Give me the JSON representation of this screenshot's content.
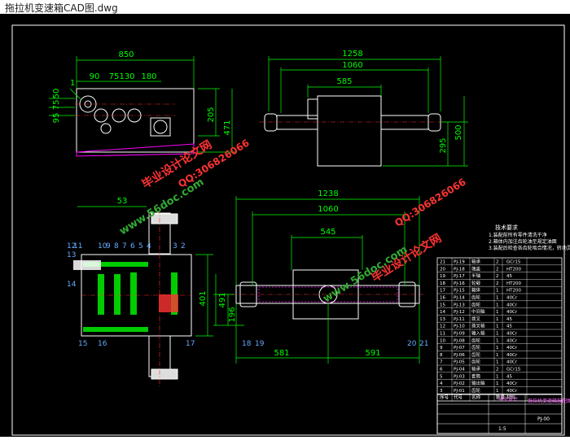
{
  "window": {
    "title": "拖拉机变速箱CAD图.dwg"
  },
  "colors": {
    "background": "#000000",
    "dimension": "#00ff00",
    "outline": "#ffffff",
    "gear": "#00cc00",
    "center": "#ff3333",
    "hatch": "#ff00ff",
    "watermark": "#ff3333",
    "watermark_url": "#33aa33"
  },
  "top_view": {
    "dims": {
      "total": "850",
      "a": "90",
      "b": "75",
      "c": "130",
      "d": "180",
      "h1": "205",
      "h2": "471",
      "v1": "95",
      "v2": "75",
      "v3": "50"
    },
    "balloon": "1"
  },
  "side_view": {
    "dims": {
      "total": "1258",
      "mid": "1060",
      "inner": "585",
      "h1": "500",
      "h2": "295"
    }
  },
  "section_view": {
    "dims": {
      "left": "53",
      "h": "401",
      "h2": "491",
      "h3": "196"
    },
    "balloons": [
      "12",
      "11",
      "13",
      "10",
      "9",
      "8",
      "7",
      "6",
      "5",
      "4",
      "3",
      "2",
      "14",
      "15",
      "16",
      "17"
    ]
  },
  "front_view": {
    "dims": {
      "total": "1238",
      "mid": "1060",
      "inner": "545",
      "left": "581",
      "right": "591"
    },
    "balloons": [
      "18",
      "19",
      "20",
      "21"
    ]
  },
  "bom": {
    "tech_title": "技术要求",
    "tech_lines": [
      "1.装配前所有零件清洗干净",
      "2.箱体内加注齿轮油至规定油面",
      "3.装配后检查各齿轮啮合情况，转动灵活"
    ],
    "rows": [
      {
        "no": "21",
        "code": "PJ-19",
        "name": "轴承",
        "qty": "2",
        "mat": "GCr15"
      },
      {
        "no": "20",
        "code": "PJ-18",
        "name": "端盖",
        "qty": "2",
        "mat": "HT200"
      },
      {
        "no": "19",
        "code": "PJ-17",
        "name": "半轴",
        "qty": "2",
        "mat": "45"
      },
      {
        "no": "18",
        "code": "PJ-16",
        "name": "轮毂",
        "qty": "2",
        "mat": "HT200"
      },
      {
        "no": "17",
        "code": "PJ-15",
        "name": "箱体",
        "qty": "1",
        "mat": "HT200"
      },
      {
        "no": "16",
        "code": "PJ-14",
        "name": "齿轮",
        "qty": "1",
        "mat": "40Cr"
      },
      {
        "no": "15",
        "code": "PJ-13",
        "name": "齿轮",
        "qty": "1",
        "mat": "40Cr"
      },
      {
        "no": "14",
        "code": "PJ-12",
        "name": "中间轴",
        "qty": "1",
        "mat": "40Cr"
      },
      {
        "no": "13",
        "code": "PJ-11",
        "name": "拨叉",
        "qty": "1",
        "mat": "45"
      },
      {
        "no": "12",
        "code": "PJ-10",
        "name": "拨叉轴",
        "qty": "1",
        "mat": "45"
      },
      {
        "no": "11",
        "code": "PJ-09",
        "name": "输入轴",
        "qty": "1",
        "mat": "40Cr"
      },
      {
        "no": "10",
        "code": "PJ-08",
        "name": "齿轮",
        "qty": "1",
        "mat": "40Cr"
      },
      {
        "no": "9",
        "code": "PJ-07",
        "name": "齿轮",
        "qty": "1",
        "mat": "40Cr"
      },
      {
        "no": "8",
        "code": "PJ-06",
        "name": "齿轮",
        "qty": "1",
        "mat": "40Cr"
      },
      {
        "no": "7",
        "code": "PJ-05",
        "name": "齿轮",
        "qty": "1",
        "mat": "40Cr"
      },
      {
        "no": "6",
        "code": "PJ-04",
        "name": "轴承",
        "qty": "2",
        "mat": "GCr15"
      },
      {
        "no": "5",
        "code": "PJ-03",
        "name": "套筒",
        "qty": "1",
        "mat": "45"
      },
      {
        "no": "4",
        "code": "PJ-02",
        "name": "输出轴",
        "qty": "1",
        "mat": "40Cr"
      },
      {
        "no": "3",
        "code": "PJ-01",
        "name": "齿轮",
        "qty": "1",
        "mat": "40Cr"
      }
    ],
    "header": {
      "no": "序号",
      "code": "代号",
      "name": "名称",
      "qty": "数量",
      "mat": "材料"
    },
    "title_block": {
      "drawing_name": "拖拉机变速箱装配图",
      "code": "PJ-00",
      "unit": "毕业设计",
      "scale": "1:5"
    }
  },
  "watermarks": {
    "cn": "毕业设计论文网",
    "url": "www.56doc.com",
    "qq": "QQ:306826066"
  }
}
